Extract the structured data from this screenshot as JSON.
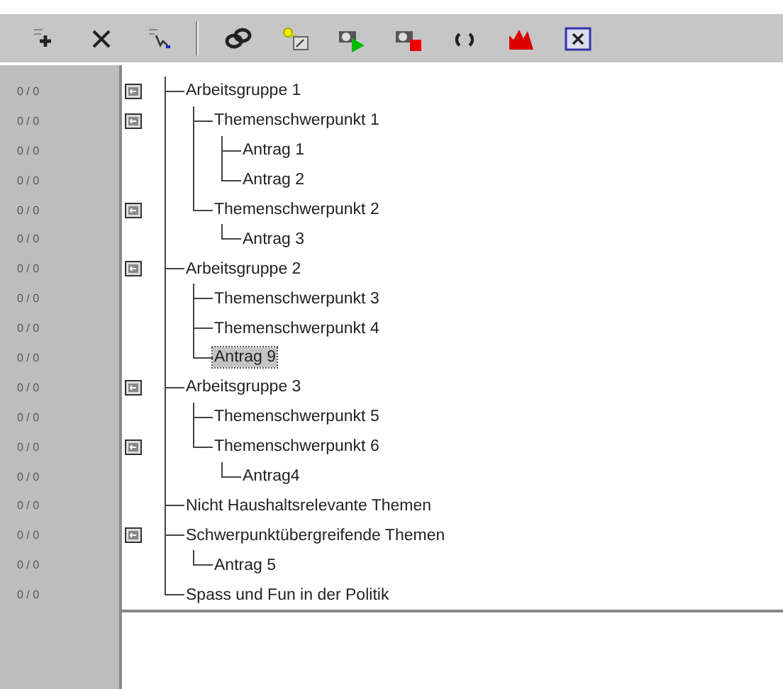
{
  "tree": [
    {
      "label": "Arbeitsgruppe 1",
      "count": "0 / 0",
      "selected": false,
      "children": [
        {
          "label": "Themenschwerpunkt 1",
          "count": "0 / 0",
          "selected": false,
          "children": [
            {
              "label": "Antrag 1",
              "count": "0 / 0",
              "selected": false
            },
            {
              "label": "Antrag 2",
              "count": "0 / 0",
              "selected": false
            }
          ]
        },
        {
          "label": "Themenschwerpunkt 2",
          "count": "0 / 0",
          "selected": false,
          "children": [
            {
              "label": "Antrag 3",
              "count": "0 / 0",
              "selected": false
            }
          ]
        }
      ]
    },
    {
      "label": "Arbeitsgruppe 2",
      "count": "0 / 0",
      "selected": false,
      "children": [
        {
          "label": "Themenschwerpunkt 3",
          "count": "0 / 0",
          "selected": false
        },
        {
          "label": "Themenschwerpunkt 4",
          "count": "0 / 0",
          "selected": false
        },
        {
          "label": "Antrag 9",
          "count": "0 / 0",
          "selected": true
        }
      ]
    },
    {
      "label": "Arbeitsgruppe 3",
      "count": "0 / 0",
      "selected": false,
      "children": [
        {
          "label": "Themenschwerpunkt 5",
          "count": "0 / 0",
          "selected": false
        },
        {
          "label": "Themenschwerpunkt 6",
          "count": "0 / 0",
          "selected": false,
          "children": [
            {
              "label": "Antrag4",
              "count": "0 / 0",
              "selected": false
            }
          ]
        }
      ]
    },
    {
      "label": "Nicht Haushaltsrelevante Themen",
      "count": "0 / 0",
      "selected": false
    },
    {
      "label": "Schwerpunktübergreifende Themen",
      "count": "0 / 0",
      "selected": false,
      "children": [
        {
          "label": "Antrag 5",
          "count": "0 / 0",
          "selected": false
        }
      ]
    },
    {
      "label": "Spass und Fun in der Politik",
      "count": "0 / 0",
      "selected": false
    }
  ]
}
